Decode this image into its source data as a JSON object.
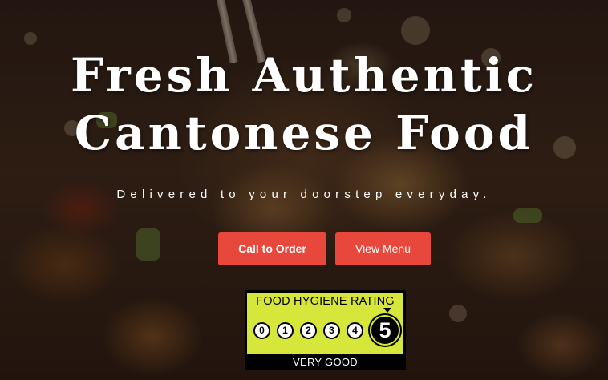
{
  "hero": {
    "headline_line1": "Fresh Authentic",
    "headline_line2": "Cantonese Food",
    "subheadline": "Delivered to your doorstep everyday.",
    "background_image": "cantonese-dish-photo"
  },
  "actions": {
    "call_label": "Call to Order",
    "menu_label": "View Menu",
    "accent_color": "#e8473b"
  },
  "hygiene_rating": {
    "title": "FOOD HYGIENE RATING",
    "scale": [
      "0",
      "1",
      "2",
      "3",
      "4"
    ],
    "score": "5",
    "label": "VERY GOOD",
    "badge_color": "#d7e63a"
  }
}
